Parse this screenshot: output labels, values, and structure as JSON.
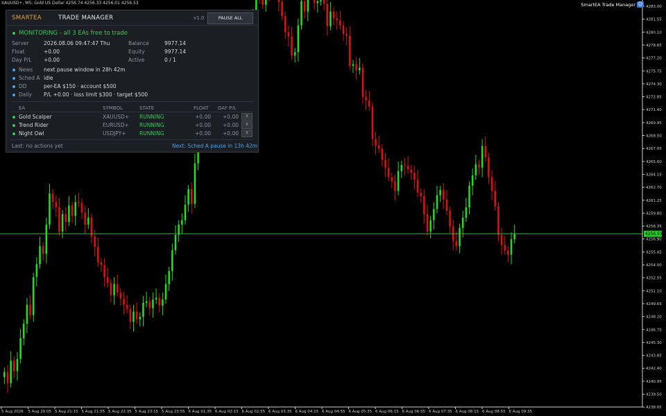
{
  "topbar": {
    "text": "XAUUSD+, M5:  Gold US Dollar  4256.74 4256.33 4256.01 4256.53"
  },
  "ea_label": "SmartEA Trade Manager",
  "panel": {
    "brand": "SMARTEA",
    "title": "TRADE MANAGER",
    "version": "v1.0",
    "pause_all": "PAUSE ALL",
    "status": "MONITORING - all 3 EAs free to trade",
    "server_label": "Server",
    "server_value": "2026.08.06 09:47:47 Thu",
    "balance_label": "Balance",
    "balance_value": "9977.14",
    "float_label": "Float",
    "float_value": "+0.00",
    "equity_label": "Equity",
    "equity_value": "9977.14",
    "daypl_label": "Day P/L",
    "daypl_value": "+0.00",
    "active_label": "Active",
    "active_value": "0 / 1",
    "news_label": "News",
    "news_value": "next pause window in 28h 42m",
    "sched_label": "Sched A",
    "sched_value": "idle",
    "dd_label": "DD",
    "dd_value": "per-EA $150  ·  account $500",
    "daily_label": "Daily",
    "daily_value": "P/L +0.00  ·  loss limit $300  ·  target $500",
    "cols": {
      "ea": "EA",
      "symbol": "SYMBOL",
      "state": "STATE",
      "float": "FLOAT",
      "daypl": "DAY P/L"
    },
    "rows": [
      {
        "name": "Gold Scalper",
        "symbol": "XAUUSD+",
        "state": "RUNNING",
        "float": "+0.00",
        "daypl": "+0.00",
        "btn": "II"
      },
      {
        "name": "Trend Rider",
        "symbol": "EURUSD+",
        "state": "RUNNING",
        "float": "+0.00",
        "daypl": "+0.00",
        "btn": "II"
      },
      {
        "name": "Night Owl",
        "symbol": "USDJPY+",
        "state": "RUNNING",
        "float": "+0.00",
        "daypl": "+0.00",
        "btn": "II"
      }
    ],
    "last": "Last:  no actions yet",
    "next": "Next:  Sched A pause in 13h 42m"
  },
  "colors": {
    "bull": "#22dd22",
    "bear": "#dd1111",
    "bg": "#000000",
    "price_line": "#22cc22"
  },
  "chart_data": {
    "type": "candlestick",
    "symbol": "XAUUSD+",
    "timeframe": "M5",
    "current_price": "4256.53",
    "ylim": [
      4237.0,
      4283.0
    ],
    "y_ticks": [
      "4283.00",
      "4281.55",
      "4280.10",
      "4278.65",
      "4277.20",
      "4275.75",
      "4274.30",
      "4272.85",
      "4271.40",
      "4269.95",
      "4268.50",
      "4267.05",
      "4265.60",
      "4264.15",
      "4262.70",
      "4261.25",
      "4259.80",
      "4258.35",
      "4256.90",
      "4255.45",
      "4254.00",
      "4252.55",
      "4251.10",
      "4249.65",
      "4248.20",
      "4246.75",
      "4245.30",
      "4243.85",
      "4242.40",
      "4240.95",
      "4239.50",
      "4238.05"
    ],
    "x_labels": [
      "5 Aug 2026",
      "5 Aug 20:05",
      "5 Aug 21:15",
      "5 Aug 21:55",
      "5 Aug 22:35",
      "5 Aug 23:15",
      "5 Aug 23:55",
      "6 Aug 01:35",
      "6 Aug 02:15",
      "6 Aug 02:55",
      "6 Aug 03:35",
      "6 Aug 04:15",
      "6 Aug 04:55",
      "6 Aug 05:35",
      "6 Aug 06:15",
      "6 Aug 06:55",
      "6 Aug 07:35",
      "6 Aug 08:15",
      "6 Aug 08:55",
      "6 Aug 09:35"
    ],
    "closes": [
      4240.5,
      4239.2,
      4241.8,
      4240.6,
      4242.0,
      4244.4,
      4246.1,
      4248.3,
      4247.1,
      4251.5,
      4253.0,
      4255.1,
      4254.2,
      4257.6,
      4261.2,
      4260.2,
      4259.6,
      4256.8,
      4258.8,
      4257.9,
      4259.8,
      4258.6,
      4260.2,
      4260.1,
      4259.0,
      4257.6,
      4258.4,
      4256.2,
      4255.0,
      4253.2,
      4252.9,
      4251.5,
      4250.8,
      4249.4,
      4250.7,
      4249.7,
      4249.0,
      4248.3,
      4247.8,
      4246.3,
      4247.5,
      4246.6,
      4246.9,
      4248.5,
      4248.7,
      4247.9,
      4248.9,
      4249.1,
      4248.2,
      4248.9,
      4250.7,
      4252.2,
      4254.6,
      4256.4,
      4257.6,
      4258.1,
      4259.9,
      4261.7,
      4260.0,
      4264.7,
      4267.4,
      4272.0,
      4276.8,
      4279.0,
      4278.7,
      4277.1,
      4273.5,
      4271.0,
      4271.6,
      4273.0,
      4274.4,
      4278.1,
      4279.9,
      4279.7,
      4278.7,
      4278.2,
      4280.2,
      4281.5,
      4285.5,
      4284.3,
      4283.1,
      4285.7,
      4284.6,
      4287.0,
      4285.8,
      4283.4,
      4281.8,
      4279.9,
      4279.4,
      4277.2,
      4277.6,
      4280.7,
      4283.5,
      4282.3,
      4285.3,
      4286.6,
      4283.3,
      4283.5,
      4285.5,
      4283.2,
      4280.6,
      4282.3,
      4281.5,
      4281.3,
      4280.7,
      4279.7,
      4279.5,
      4276.0,
      4276.2,
      4275.5,
      4275.8,
      4272.4,
      4272.0,
      4271.3,
      4267.5,
      4266.8,
      4266.4,
      4265.1,
      4264.2,
      4263.1,
      4262.6,
      4261.5,
      4263.8,
      4264.5,
      4264.4,
      4264.0,
      4263.6,
      4262.8,
      4261.3,
      4260.9,
      4258.8,
      4256.8,
      4258.1,
      4259.4,
      4261.0,
      4261.6,
      4260.5,
      4259.2,
      4257.4,
      4255.7,
      4255.1,
      4257.2,
      4258.4,
      4259.6,
      4262.1,
      4263.3,
      4264.6,
      4264.2,
      4266.7,
      4265.4,
      4263.1,
      4261.5,
      4259.7,
      4256.4,
      4255.2,
      4254.6,
      4254.1,
      4255.9,
      4256.5
    ]
  }
}
